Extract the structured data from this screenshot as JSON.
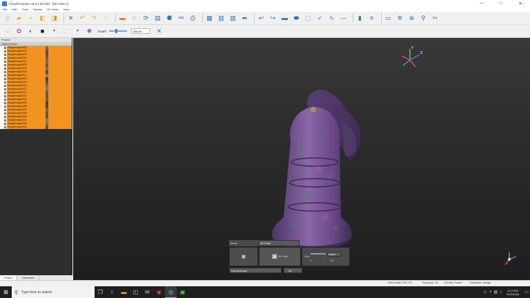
{
  "window": {
    "title": "CloudCompare v2.9.1 [64-bit] - [3D View 1]",
    "minimize": "—",
    "maximize": "□",
    "close": "✕"
  },
  "menu": [
    "File",
    "Edit",
    "Tools",
    "Display",
    "3D Views",
    "Help"
  ],
  "toolbar_bottom": {
    "depth_label": "Depth",
    "depth_value": "256.00"
  },
  "db_tree": {
    "title": "Project",
    "header": "Object Name",
    "rows": [
      {
        "name": "RangeImage0025",
        "color": "#3a8a3a"
      },
      {
        "name": "RangeImage0024",
        "color": "#6c3a8a"
      },
      {
        "name": "RangeImage0023",
        "color": "#8a3a3a"
      },
      {
        "name": "RangeImage0022",
        "color": "#3a6c8a"
      },
      {
        "name": "RangeImage0021",
        "color": "#8a6c3a"
      },
      {
        "name": "RangeImage0020",
        "color": "#8a3a6c"
      },
      {
        "name": "RangeImage0019",
        "color": "#3a8a6c"
      },
      {
        "name": "RangeImage0018",
        "color": "#5a3a8a"
      },
      {
        "name": "RangeImage0017",
        "color": "#8a8a3a"
      },
      {
        "name": "RangeImage0016",
        "color": "#3a3a8a"
      },
      {
        "name": "RangeImage0015",
        "color": "#8a3a3a"
      },
      {
        "name": "RangeImage0014",
        "color": "#3a8a8a"
      },
      {
        "name": "RangeImage0013",
        "color": "#6c8a3a"
      },
      {
        "name": "RangeImage0012",
        "color": "#8a3a8a"
      },
      {
        "name": "RangeImage0011",
        "color": "#3a6c3a"
      },
      {
        "name": "RangeImage0010",
        "color": "#8a5a3a"
      },
      {
        "name": "RangeImage0009",
        "color": "#3a3a6c"
      },
      {
        "name": "RangeImage0008",
        "color": "#6c3a3a"
      },
      {
        "name": "RangeImage0007",
        "color": "#3a8a3a"
      },
      {
        "name": "RangeImage0006",
        "color": "#8a3a5a"
      },
      {
        "name": "RangeImage0005",
        "color": "#3a5a8a"
      },
      {
        "name": "RangeImage0004",
        "color": "#8a8a3a"
      },
      {
        "name": "RangeImage0003",
        "color": "#5a8a3a"
      },
      {
        "name": "RangeImage0002",
        "color": "#8a3a3a"
      }
    ],
    "tabs": [
      "Project",
      "Interaction"
    ]
  },
  "capture_panel": {
    "mode_label": "Mode",
    "mode_value": "3D Point",
    "snapshot_label": "3D Point",
    "contrast_label": "Cont",
    "contrast_value": "Adjust",
    "contrast_min": "0",
    "contrast_max": "100",
    "range_type": "RangeImage",
    "range_number": "26"
  },
  "status": {
    "left": "Field Width: 201.170",
    "exposure": "Exposure: 10",
    "format": "Format: Frame",
    "command": "Command: Range"
  },
  "taskbar": {
    "search_placeholder": "Type here to search",
    "time": "6:17 PM",
    "date": "5/22/2018"
  },
  "colors": {
    "tree_orange": "#f2931f",
    "viewport_top": "#393939",
    "viewport_bottom": "#1e1e1e",
    "mesh_purple": "#6c4a8a"
  }
}
